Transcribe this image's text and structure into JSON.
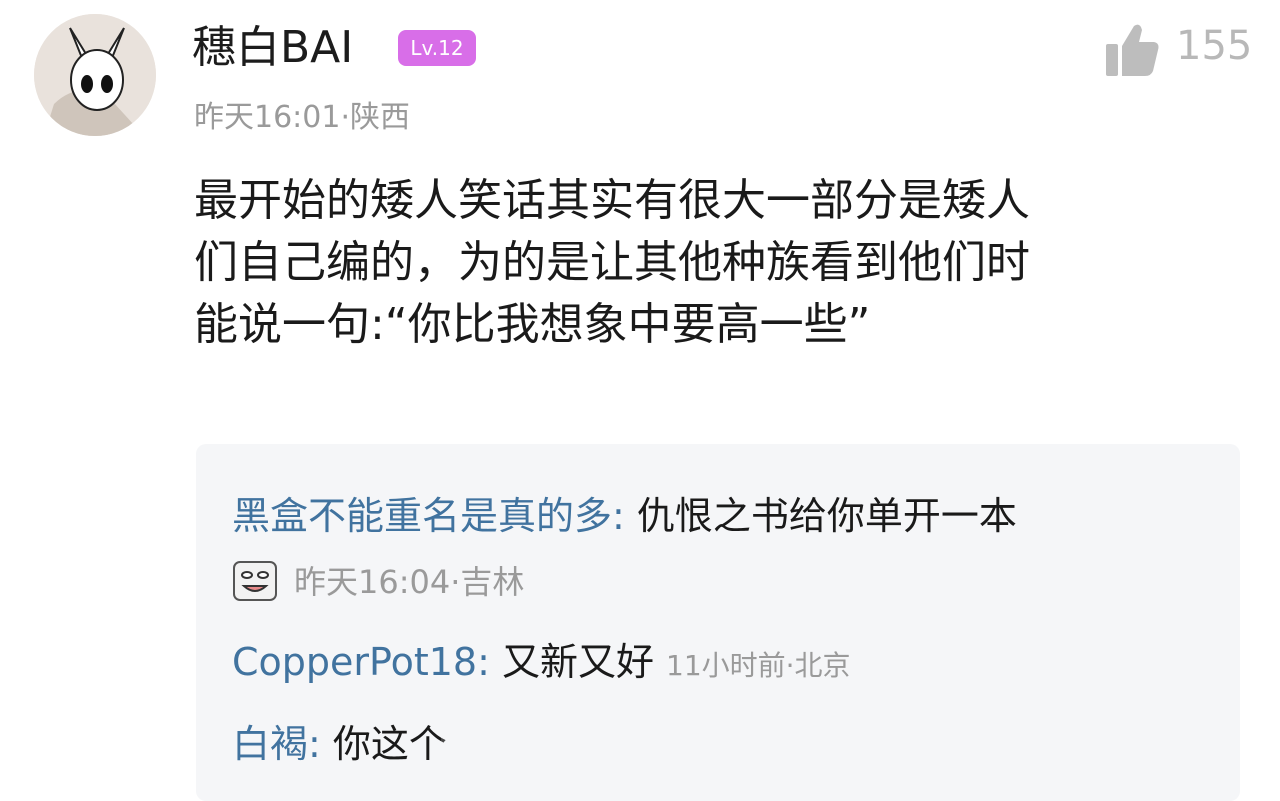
{
  "post": {
    "username": "穗白BAI",
    "level": "Lv.12",
    "likes": "155",
    "time_location": "昨天16:01·陕西",
    "content": "最开始的矮人笑话其实有很大一部分是矮人\n们自己编的，为的是让其他种族看到他们时\n能说一句:“你比我想象中要高一些”"
  },
  "replies": [
    {
      "name": "黑盒不能重名是真的多",
      "sep": ": ",
      "text": "仇恨之书给你单开一本",
      "time_location": "昨天16:04·吉林"
    },
    {
      "name": "CopperPot18",
      "sep": ": ",
      "text": "又新又好",
      "time_location": "11小时前·北京"
    },
    {
      "name": "白褐",
      "sep": ": ",
      "text": "你这个"
    }
  ]
}
